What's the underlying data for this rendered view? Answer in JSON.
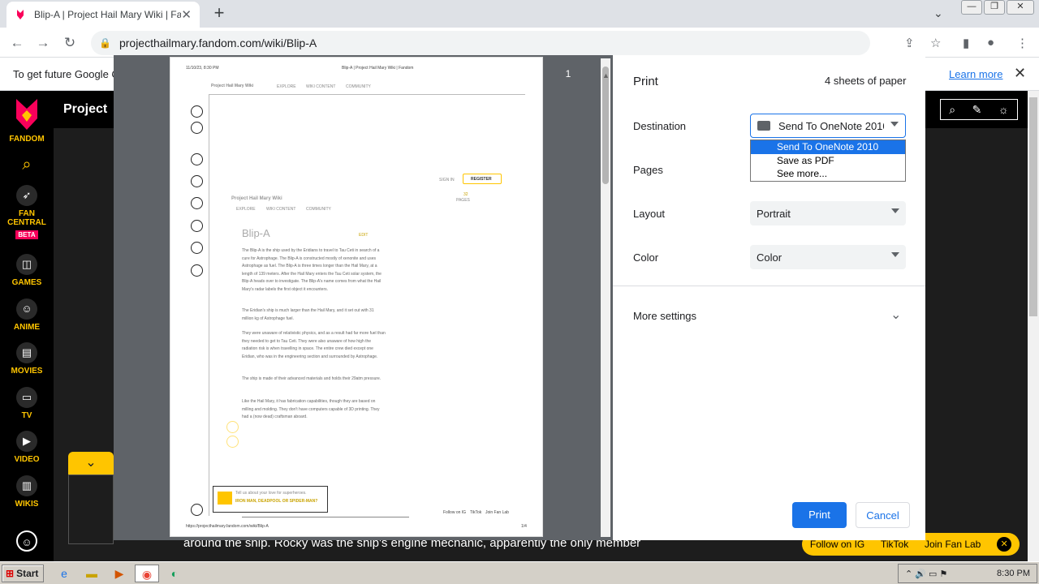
{
  "browser": {
    "tab_title": "Blip-A | Project Hail Mary Wiki | Fandom",
    "tab_close": "✕",
    "new_tab": "+",
    "url": "projecthailmary.fandom.com/wiki/Blip-A",
    "info_message": "To get future Google C",
    "learn_more": "Learn more"
  },
  "rail": {
    "items": [
      {
        "label": "FANDOM",
        "icon": "fandom-logo"
      },
      {
        "label": "FAN CENTRAL",
        "badge": "BETA",
        "icon": "rocket-icon"
      },
      {
        "label": "GAMES",
        "icon": "gamepad-icon"
      },
      {
        "label": "ANIME",
        "icon": "anime-icon"
      },
      {
        "label": "MOVIES",
        "icon": "clapper-icon"
      },
      {
        "label": "TV",
        "icon": "tv-icon"
      },
      {
        "label": "VIDEO",
        "icon": "play-icon"
      },
      {
        "label": "WIKIS",
        "icon": "book-icon"
      }
    ]
  },
  "fandom": {
    "header_title": "Project",
    "bottom_text": "around the ship. Rocky was the ship's engine mechanic, apparently the only member",
    "follow": "Follow on IG",
    "tiktok": "TikTok",
    "join": "Join Fan Lab"
  },
  "print": {
    "title": "Print",
    "sheets": "4 sheets of paper",
    "destination_label": "Destination",
    "destination_value": "Send To OneNote 2010",
    "options": [
      "Send To OneNote 2010",
      "Save as PDF",
      "See more..."
    ],
    "pages_label": "Pages",
    "layout_label": "Layout",
    "layout_value": "Portrait",
    "color_label": "Color",
    "color_value": "Color",
    "more_settings": "More settings",
    "print_button": "Print",
    "cancel_button": "Cancel",
    "page_number": "1"
  },
  "preview": {
    "header_date": "11/10/23, 8:30 PM",
    "header_title": "Blip-A | Project Hail Mary Wiki | Fandom",
    "wiki_name": "Project Hail Mary Wiki",
    "nav": [
      "EXPLORE",
      "WIKI CONTENT",
      "COMMUNITY"
    ],
    "sign_in": "SIGN IN",
    "register": "REGISTER",
    "pages_count": "32",
    "pages_word": "PAGES",
    "article_title": "Blip-A",
    "edit": "EDIT",
    "footer_url": "https://projecthailmary.fandom.com/wiki/Blip-A",
    "footer_page": "1/4",
    "promo_text": "Tell us about your love for superheroes.",
    "promo_link": "IRON MAN, DEADPOOL OR SPIDER-MAN?",
    "footer_links": [
      "Follow on IG",
      "TikTok",
      "Join Fan Lab"
    ],
    "p1": "The Blip-A is the ship used by the Eridians to travel to Tau Ceti in search of a cure for Astrophage. The Blip-A is constructed mostly of xenonite and uses Astrophage as fuel. The Blip-A is three times longer than the Hail Mary, at a length of 139 meters. After the Hail Mary enters the Tau Ceti solar system, the Blip-A heads over to investigate. The Blip-A's name comes from what the Hail Mary's radar labels the first object it encounters.",
    "p2": "The Eridian's ship is much larger than the Hail Mary, and it set out with 31 million kg of Astrophage fuel.",
    "p3": "They were unaware of relativistic physics, and as a result had far more fuel than they needed to get to Tau Ceti. They were also unaware of how high the radiation risk is when travelling in space. The entire crew died except one Eridian, who was in the engineering section and surrounded by Astrophage.",
    "p4": "The ship is made of their advanced materials and holds their 29atm pressure.",
    "p5": "Like the Hail Mary, it has fabrication capabilities, though they are based on milling and molding. They don't have computers capable of 3D printing. They had a (now dead) craftsman aboard."
  },
  "taskbar": {
    "start": "Start",
    "time": "8:30 PM"
  }
}
